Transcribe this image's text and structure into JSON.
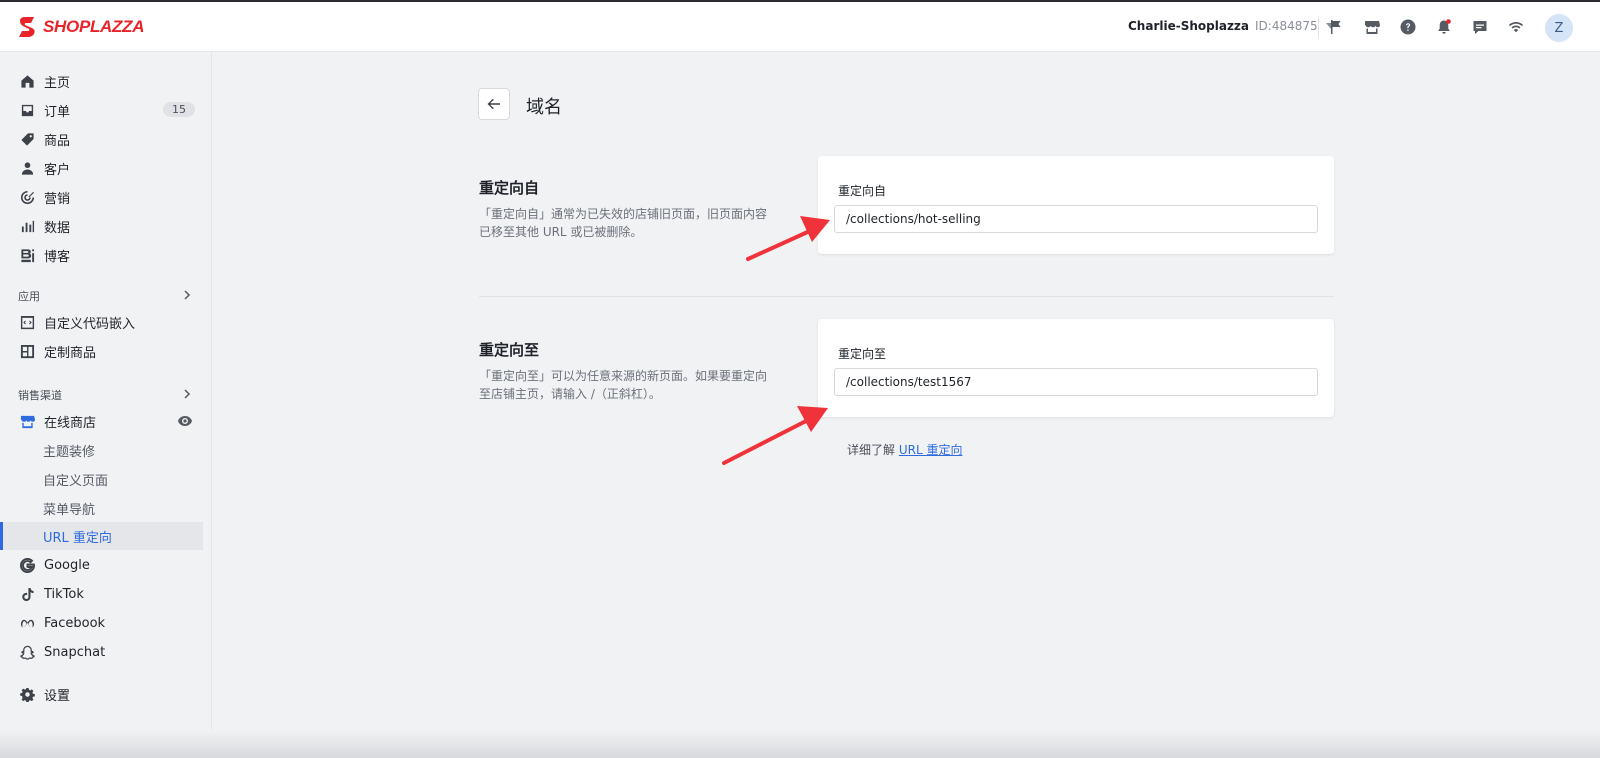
{
  "brand": {
    "name": "SHOPLAZZA",
    "color": "#e8242b"
  },
  "header": {
    "store_name": "Charlie-Shoplazza",
    "store_id": "ID:484875",
    "avatar_initial": "Z",
    "icons": [
      "flag-icon",
      "store-icon",
      "help-icon",
      "bell-icon",
      "message-icon",
      "wifi-icon"
    ]
  },
  "sidebar": {
    "items": [
      {
        "label": "主页",
        "icon": "home-icon"
      },
      {
        "label": "订单",
        "icon": "inbox-icon",
        "badge": "15"
      },
      {
        "label": "商品",
        "icon": "tag-icon"
      },
      {
        "label": "客户",
        "icon": "person-icon"
      },
      {
        "label": "营销",
        "icon": "target-icon"
      },
      {
        "label": "数据",
        "icon": "bar-chart-icon"
      },
      {
        "label": "博客",
        "icon": "blog-icon"
      }
    ],
    "apps_label": "应用",
    "apps": [
      {
        "label": "自定义代码嵌入",
        "icon": "code-embed-icon"
      },
      {
        "label": "定制商品",
        "icon": "custom-product-icon"
      }
    ],
    "channels_label": "销售渠道",
    "online_store": {
      "label": "在线商店",
      "icon": "storefront-icon"
    },
    "online_store_sub": [
      {
        "label": "主题装修"
      },
      {
        "label": "自定义页面"
      },
      {
        "label": "菜单导航"
      },
      {
        "label": "URL 重定向",
        "active": true
      }
    ],
    "channels": [
      {
        "label": "Google",
        "icon": "google-icon"
      },
      {
        "label": "TikTok",
        "icon": "tiktok-icon"
      },
      {
        "label": "Facebook",
        "icon": "meta-icon"
      },
      {
        "label": "Snapchat",
        "icon": "snapchat-icon"
      }
    ],
    "settings": {
      "label": "设置",
      "icon": "gear-icon"
    },
    "accent_color": "#2f6be0"
  },
  "main": {
    "title": "域名",
    "from": {
      "title": "重定向自",
      "desc": "「重定向自」通常为已失效的店铺旧页面，旧页面内容已移至其他 URL 或已被删除。",
      "field_label": "重定向自",
      "value": "/collections/hot-selling"
    },
    "to": {
      "title": "重定向至",
      "desc": "「重定向至」可以为任意来源的新页面。如果要重定向至店铺主页，请输入 /（正斜杠）。",
      "field_label": "重定向至",
      "value": "/collections/test1567"
    },
    "learn_more_prefix": "详细了解",
    "learn_more_link": "URL 重定向"
  },
  "annotation_color": "#f0323a"
}
